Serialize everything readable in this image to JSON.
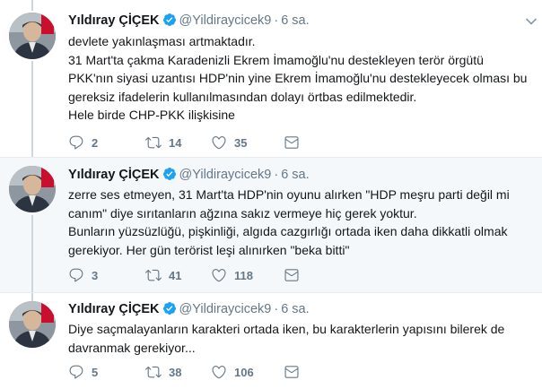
{
  "tweets": [
    {
      "name": "Yıldıray ÇİÇEK",
      "handle": "@Yildiraycicek9",
      "separator": "·",
      "time": "6 sa.",
      "lines": [
        "devlete yakınlaşması artmaktadır.",
        "31 Mart'ta çakma Karadenizli Ekrem İmamoğlu'nu destekleyen terör örgütü",
        "PKK'nın siyasi uzantısı HDP'nin yine Ekrem İmamoğlu'nu destekleyecek olması bu",
        "gereksiz ifadelerin kullanılmasından dolayı örtbas edilmektedir.",
        "Hele birde CHP-PKK ilişkisine"
      ],
      "replies": "2",
      "retweets": "14",
      "likes": "35"
    },
    {
      "name": "Yıldıray ÇİÇEK",
      "handle": "@Yildiraycicek9",
      "separator": "·",
      "time": "6 sa.",
      "lines": [
        "zerre ses etmeyen, 31 Mart'ta HDP'nin oyunu alırken \"HDP meşru parti değil mi",
        "canım\" diye sırıtanların ağzına sakız vermeye hiç gerek yoktur.",
        "Bunların yüzsüzlüğü, pişkinliği, algıda cazgırlığı ortada iken daha dikkatli olmak",
        "gerekiyor. Her gün terörist leşi alınırken \"beka bitti\""
      ],
      "replies": "3",
      "retweets": "41",
      "likes": "118"
    },
    {
      "name": "Yıldıray ÇİÇEK",
      "handle": "@Yildiraycicek9",
      "separator": "·",
      "time": "6 sa.",
      "lines": [
        "Diye saçmalayanların karakteri ortada iken, bu karakterlerin yapısını bilerek de",
        "davranmak gerekiyor..."
      ],
      "replies": "5",
      "retweets": "38",
      "likes": "106"
    }
  ],
  "icons": {
    "verified": "verified-badge-icon",
    "reply": "reply-icon",
    "retweet": "retweet-icon",
    "like": "heart-icon",
    "dm": "envelope-icon",
    "caret": "chevron-down-icon"
  },
  "colors": {
    "verified": "#1da1f2",
    "muted": "#657786",
    "thread_line": "#ccd6dd",
    "highlight_bg": "#f5f8fa"
  }
}
